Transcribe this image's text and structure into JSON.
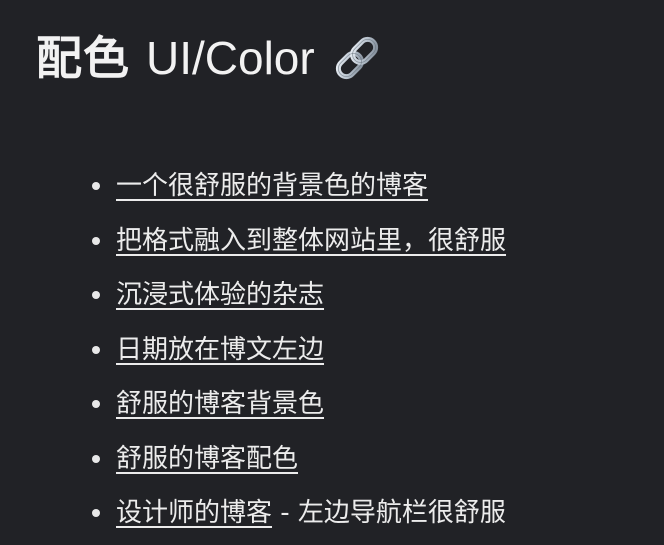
{
  "heading": {
    "cjk": "配色",
    "latin": "UI/Color",
    "icon": "link-icon"
  },
  "links": [
    {
      "label": "一个很舒服的背景色的博客"
    },
    {
      "label": "把格式融入到整体网站里，很舒服"
    },
    {
      "label": "沉浸式体验的杂志"
    },
    {
      "label": "日期放在博文左边"
    },
    {
      "label": "舒服的博客背景色"
    },
    {
      "label": "舒服的博客配色"
    },
    {
      "label": "设计师的博客",
      "suffix": " - 左边导航栏很舒服"
    }
  ],
  "colors": {
    "background": "#212226",
    "text": "#ececec"
  }
}
